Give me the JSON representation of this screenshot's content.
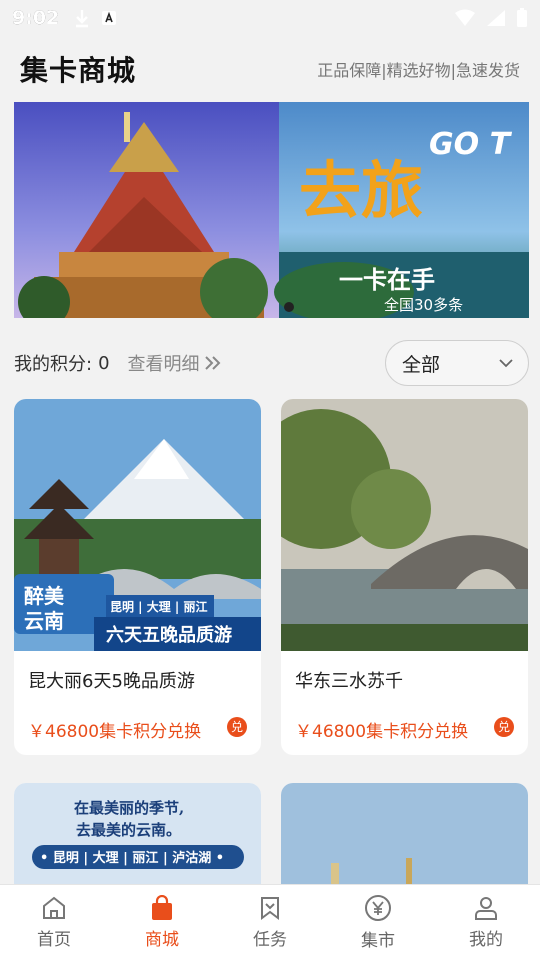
{
  "status": {
    "time": "9:02"
  },
  "header": {
    "title": "集卡商城",
    "slogan": "正品保障|精选好物|急速发货"
  },
  "banner": {
    "overlay_text_1": "去旅",
    "overlay_text_2": "GO T",
    "overlay_text_3": "一卡在手",
    "overlay_text_4": "全国30多条"
  },
  "points": {
    "label": "我的积分:",
    "value": "0",
    "detail": "查看明细"
  },
  "filter": {
    "value": "全部"
  },
  "products": [
    {
      "name": "昆大丽6天5晚品质游",
      "price": "￥46800集卡积分兑换",
      "badge": "兑",
      "img_text_a": "醉美",
      "img_text_b": "云南",
      "img_text_c": "昆明 | 大理 | 丽江",
      "img_text_d": "六天五晚品质游"
    },
    {
      "name": "华东三水苏千",
      "price": "￥46800集卡积分兑换",
      "badge": "兑"
    }
  ],
  "products_row2": [
    {
      "img_text_a": "在最美丽的季节,",
      "img_text_b": "去最美的云南。",
      "img_text_c": "• 昆明 | 大理 | 丽江 | 泸沽湖 •"
    },
    {}
  ],
  "tabs": [
    {
      "label": "首页",
      "icon": "home-icon"
    },
    {
      "label": "商城",
      "icon": "shopping-bag-icon",
      "active": true
    },
    {
      "label": "任务",
      "icon": "bookmark-icon"
    },
    {
      "label": "集市",
      "icon": "yen-coin-icon"
    },
    {
      "label": "我的",
      "icon": "user-icon"
    }
  ],
  "colors": {
    "accent": "#e94e1b",
    "background": "#f2f2f2"
  }
}
